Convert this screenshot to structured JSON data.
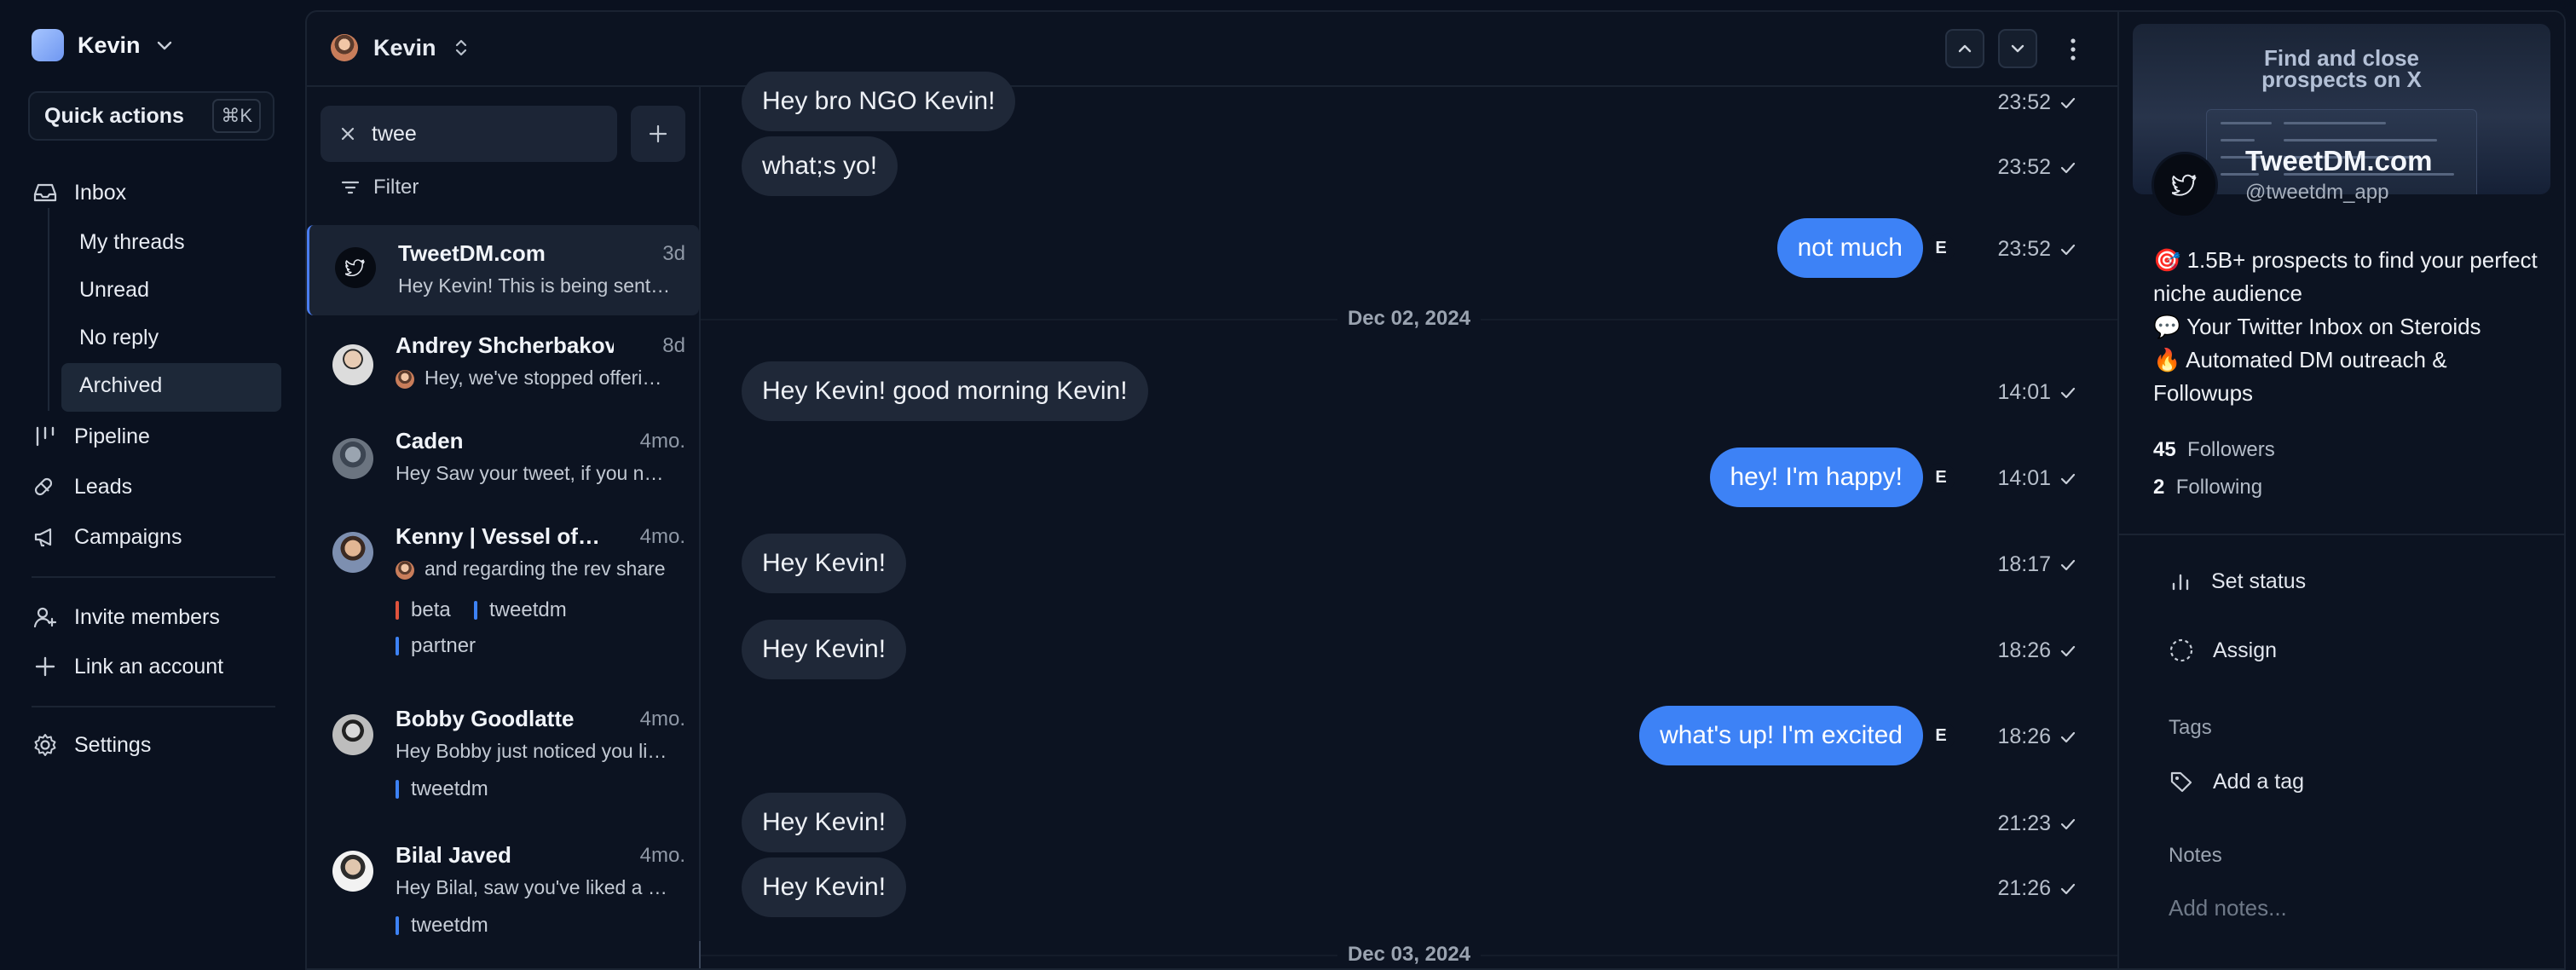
{
  "workspace": {
    "name": "Kevin"
  },
  "quick_actions": {
    "label": "Quick actions",
    "shortcut": "⌘K"
  },
  "nav": {
    "inbox": "Inbox",
    "sub": [
      "My threads",
      "Unread",
      "No reply",
      "Archived"
    ],
    "active_sub": "Archived",
    "pipeline": "Pipeline",
    "leads": "Leads",
    "campaigns": "Campaigns",
    "invite": "Invite members",
    "link": "Link an account",
    "settings": "Settings"
  },
  "topbar": {
    "account_name": "Kevin"
  },
  "search": {
    "value": "twee"
  },
  "filter_label": "Filter",
  "threads": [
    {
      "name": "TweetDM.com",
      "time": "3d",
      "preview": "Hey Kevin! This is being sent from TweetDM",
      "tags": []
    },
    {
      "name": "Andrey Shcherbakovv",
      "time": "8d",
      "preview": "Hey, we've stopped offering that plan",
      "tags": []
    },
    {
      "name": "Caden",
      "time": "4mo.",
      "preview": "Hey Saw your tweet, if you need help",
      "tags": []
    },
    {
      "name": "Kenny | Vessel of Ideas",
      "time": "4mo.",
      "preview": "and regarding the rev share",
      "tags": [
        "beta",
        "tweetdm",
        "partner"
      ]
    },
    {
      "name": "Bobby Goodlatte",
      "time": "4mo.",
      "preview": "Hey Bobby just noticed you liked",
      "tags": [
        "tweetdm"
      ]
    },
    {
      "name": "Bilal Javed",
      "time": "4mo.",
      "preview": "Hey Bilal, saw you've liked a post",
      "tags": [
        "tweetdm"
      ]
    }
  ],
  "tag_colors": {
    "beta": "#e0533d",
    "tweetdm": "#3d82f6",
    "partner": "#3d82f6"
  },
  "messages": [
    {
      "dir": "in",
      "text": "Hey bro NGO Kevin!",
      "time": "23:52"
    },
    {
      "dir": "in",
      "text": "what;s yo!",
      "time": "23:52"
    },
    {
      "dir": "out",
      "text": "not much",
      "time": "23:52",
      "sender": "E"
    },
    {
      "dir": "date",
      "text": "Dec 02, 2024"
    },
    {
      "dir": "in",
      "text": "Hey Kevin! good morning Kevin!",
      "time": "14:01"
    },
    {
      "dir": "out",
      "text": "hey! I'm happy!",
      "time": "14:01",
      "sender": "E"
    },
    {
      "dir": "in",
      "text": "Hey Kevin!",
      "time": "18:17"
    },
    {
      "dir": "in",
      "text": "Hey Kevin!",
      "time": "18:26"
    },
    {
      "dir": "out",
      "text": "what's up! I'm excited",
      "time": "18:26",
      "sender": "E"
    },
    {
      "dir": "in",
      "text": "Hey Kevin!",
      "time": "21:23"
    },
    {
      "dir": "in",
      "text": "Hey Kevin!",
      "time": "21:26"
    },
    {
      "dir": "date",
      "text": "Dec 03, 2024"
    }
  ],
  "profile": {
    "banner_text_1": "Find and close",
    "banner_text_2": "prospects on X",
    "name": "TweetDM.com",
    "handle": "@tweetdm_app",
    "bio": [
      "🎯 1.5B+ prospects to find your perfect niche audience",
      "💬 Your Twitter Inbox on Steroids",
      "🔥 Automated DM outreach & Followups"
    ],
    "followers_count": "45",
    "followers_label": "Followers",
    "following_count": "2",
    "following_label": "Following"
  },
  "panel": {
    "set_status": "Set status",
    "assign": "Assign",
    "tags_title": "Tags",
    "add_tag": "Add a tag",
    "notes_title": "Notes",
    "notes_placeholder": "Add notes..."
  },
  "colors": {
    "accent": "#3d82f6",
    "background": "#0a111f",
    "bubble_in": "#1f2838"
  }
}
